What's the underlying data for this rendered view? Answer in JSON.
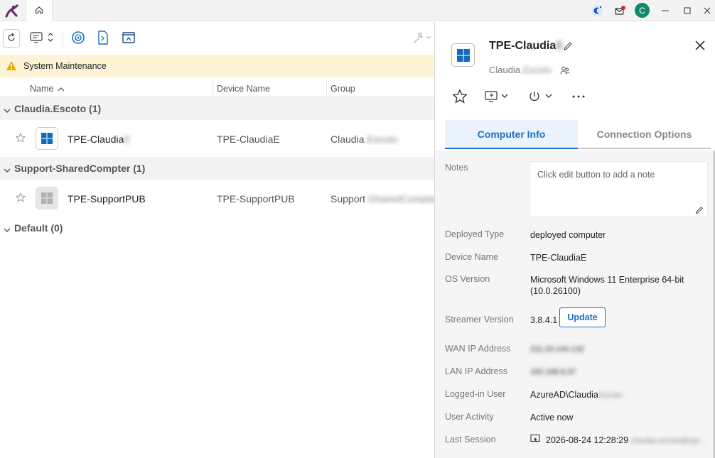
{
  "titlebar": {
    "home_tab": "home-icon",
    "avatar_letter": "C",
    "icons": [
      "assistant-icon",
      "notification-icon",
      "minimize-icon",
      "maximize-icon",
      "close-icon"
    ]
  },
  "toolbar": {
    "icons": [
      "refresh-icon",
      "view-mode-icon",
      "remote-access-icon",
      "remote-shell-icon",
      "screen-icon",
      "wrench-icon"
    ]
  },
  "banner": {
    "text": "System Maintenance"
  },
  "columns": {
    "name": "Name",
    "device": "Device Name",
    "group": "Group"
  },
  "groups": [
    {
      "label": "Claudia.Escoto",
      "count": "(1)",
      "rows": [
        {
          "name": "TPE-Claudia",
          "name_hidden": "E",
          "device": "TPE-ClaudiaE",
          "group": "Claudia",
          "group_hidden": ".Escoto",
          "os": "windows"
        }
      ]
    },
    {
      "label": "Support-SharedCompter",
      "count": "(1)",
      "rows": [
        {
          "name": "TPE-SupportPUB",
          "name_hidden": "",
          "device": "TPE-SupportPUB",
          "group": "Support",
          "group_hidden": "-SharedCompter",
          "os": "generic"
        }
      ]
    },
    {
      "label": "Default",
      "count": "(0)",
      "rows": []
    }
  ],
  "detail": {
    "title": "TPE-Claudia",
    "title_hidden": "E",
    "subtitle": "Claudia",
    "subtitle_hidden": ".Escoto",
    "tabs": {
      "info": "Computer Info",
      "connection": "Connection Options"
    },
    "notes_label": "Notes",
    "notes_placeholder": "Click edit button to add a note",
    "fields": {
      "deployed_type": {
        "label": "Deployed Type",
        "value": "deployed computer"
      },
      "device_name": {
        "label": "Device Name",
        "value": "TPE-ClaudiaE"
      },
      "os_version": {
        "label": "OS Version",
        "value": "Microsoft Windows 11 Enterprise 64-bit",
        "value2": "(10.0.26100)"
      },
      "streamer_version": {
        "label": "Streamer Version",
        "value": "3.8.4.1",
        "button": "Update"
      },
      "wan_ip": {
        "label": "WAN IP Address",
        "value_hidden": "211.23.144.132"
      },
      "lan_ip": {
        "label": "LAN IP Address",
        "value_hidden": "192.168.8.37"
      },
      "logged_user": {
        "label": "Logged-in User",
        "value": "AzureAD\\Claudia",
        "value_hidden": "Escoto"
      },
      "user_activity": {
        "label": "User Activity",
        "value": "Active now"
      },
      "last_session": {
        "label": "Last Session",
        "value": "2026-08-24 12:28:29",
        "value_hidden": "claudia.escoto@spl..."
      }
    }
  },
  "colors": {
    "accent": "#1a6fc4",
    "banner_bg": "#fdf4d6",
    "group_bg": "#f3f3f3",
    "avatar": "#0f8a6e",
    "logo": "#6b2d6e"
  }
}
